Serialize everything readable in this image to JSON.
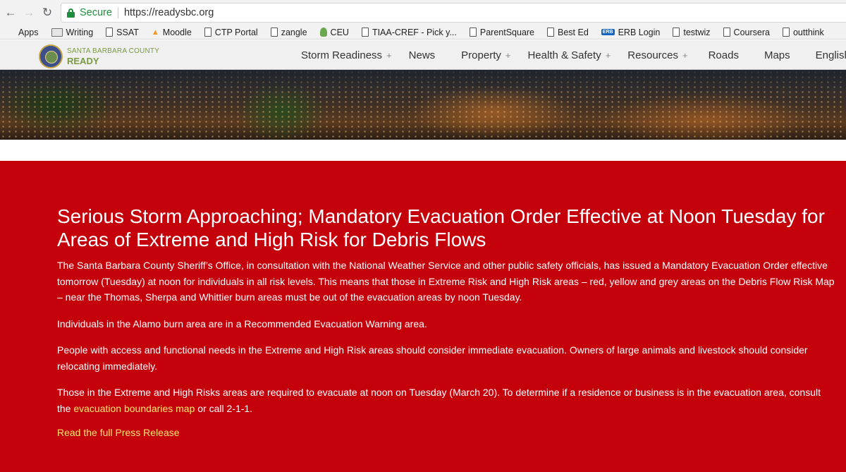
{
  "browser": {
    "secure_label": "Secure",
    "url": "https://readysbc.org",
    "bookmarks": [
      {
        "label": "Apps",
        "icon": "apps-grid-icon"
      },
      {
        "label": "Writing",
        "icon": "folder-icon"
      },
      {
        "label": "SSAT",
        "icon": "page-icon"
      },
      {
        "label": "Moodle",
        "icon": "moodle-icon"
      },
      {
        "label": "CTP Portal",
        "icon": "page-icon"
      },
      {
        "label": "zangle",
        "icon": "page-icon"
      },
      {
        "label": "CEU",
        "icon": "ceu-icon"
      },
      {
        "label": "TIAA-CREF - Pick y...",
        "icon": "page-icon"
      },
      {
        "label": "ParentSquare",
        "icon": "page-icon"
      },
      {
        "label": "Best Ed",
        "icon": "page-icon"
      },
      {
        "label": "ERB Login",
        "icon": "erb-icon"
      },
      {
        "label": "testwiz",
        "icon": "page-icon"
      },
      {
        "label": "Coursera",
        "icon": "page-icon"
      },
      {
        "label": "outthink",
        "icon": "page-icon"
      }
    ],
    "erb_icon_text": "ERB"
  },
  "site": {
    "logo": {
      "county": "SANTA BARBARA COUNTY",
      "ready": "READY"
    },
    "menu": [
      {
        "label": "Storm Readiness",
        "plus": "+"
      },
      {
        "label": "News",
        "plus": ""
      },
      {
        "label": "Property",
        "plus": "+"
      },
      {
        "label": "Health & Safety",
        "plus": "+"
      },
      {
        "label": "Resources",
        "plus": "+"
      },
      {
        "label": "Roads",
        "plus": ""
      },
      {
        "label": "Maps",
        "plus": ""
      },
      {
        "label": "English",
        "plus": ""
      }
    ]
  },
  "alert": {
    "title": "Serious Storm Approaching; Mandatory Evacuation Order Effective at Noon Tuesday for Areas of Extreme and High Risk for Debris Flows",
    "p1": "The Santa Barbara County Sheriff’s Office, in consultation with the National Weather Service and other public safety officials, has issued a Mandatory Evacuation Order effective tomorrow (Tuesday) at noon for individuals in all risk levels. This means that those in Extreme Risk and High Risk areas – red, yellow and grey areas on the Debris Flow Risk Map – near the Thomas, Sherpa and Whittier burn areas must be out of the evacuation areas by noon Tuesday.",
    "p2": "Individuals in the Alamo burn area are in a Recommended Evacuation Warning area.",
    "p3": "People with access and functional needs in the Extreme and High Risk areas should consider immediate evacuation. Owners of large animals and livestock should consider relocating immediately.",
    "p4_before": "Those in the Extreme and High Risks areas are required to evacuate at noon on Tuesday (March 20). To determine if a residence or business is in the evacuation area, consult the ",
    "p4_link": "evacuation boundaries map",
    "p4_after": " or call 2-1-1.",
    "press_link": "Read the full Press Release"
  },
  "colors": {
    "alert_bg": "#c4000b",
    "link": "#ffe86b",
    "secure_green": "#1e8e3e",
    "logo_green": "#7a9a42"
  }
}
